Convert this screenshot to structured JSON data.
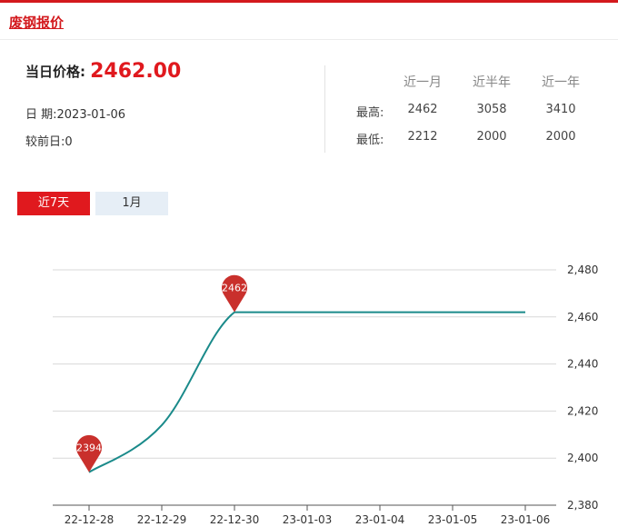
{
  "header": {
    "title": "废钢报价"
  },
  "summary": {
    "price_label": "当日价格:",
    "price_value": "2462.00",
    "date_label": "日 期:",
    "date_value": "2023-01-06",
    "change_label": "较前日:",
    "change_value": "0"
  },
  "stats": {
    "columns": [
      "近一月",
      "近半年",
      "近一年"
    ],
    "rows": [
      {
        "label": "最高:",
        "values": [
          "2462",
          "3058",
          "3410"
        ]
      },
      {
        "label": "最低:",
        "values": [
          "2212",
          "2000",
          "2000"
        ]
      }
    ]
  },
  "tabs": [
    {
      "label": "近7天",
      "active": true
    },
    {
      "label": "1月",
      "active": false
    }
  ],
  "colors": {
    "brand": "#d3191d",
    "price": "#e0191e",
    "line": "#1a8a8a",
    "marker": "#c9302c",
    "grid": "#d8d8d8"
  },
  "chart_data": {
    "type": "line",
    "x": [
      "22-12-28",
      "22-12-29",
      "22-12-30",
      "23-01-03",
      "23-01-04",
      "23-01-05",
      "23-01-06"
    ],
    "series": [
      {
        "values": [
          2394,
          2414,
          2462,
          2462,
          2462,
          2462,
          2462
        ]
      }
    ],
    "ylim": [
      2380,
      2480
    ],
    "yticks": [
      2380,
      2400,
      2420,
      2440,
      2460,
      2480
    ],
    "ytick_labels": [
      "2,380",
      "2,400",
      "2,420",
      "2,440",
      "2,460",
      "2,480"
    ],
    "y_axis_position": "right",
    "grid": true,
    "annotations": [
      {
        "x": "22-12-28",
        "value": 2394,
        "label": "2394"
      },
      {
        "x": "22-12-30",
        "value": 2462,
        "label": "2462"
      }
    ],
    "title": "",
    "xlabel": "",
    "ylabel": ""
  }
}
